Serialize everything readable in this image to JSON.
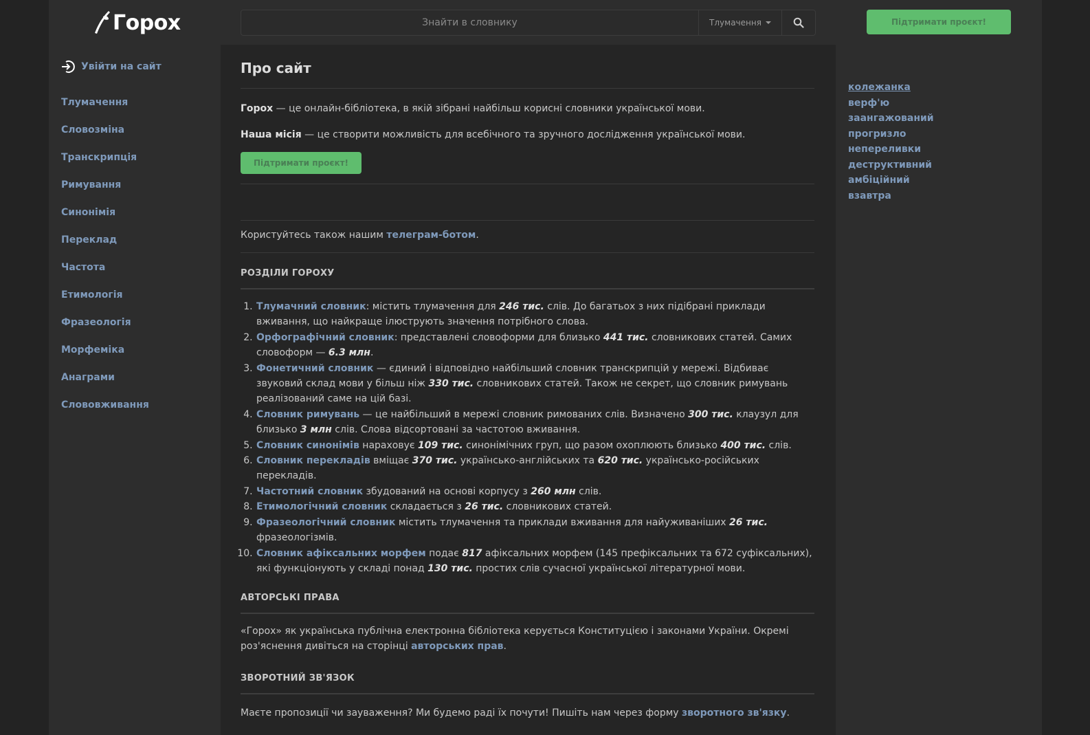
{
  "header": {
    "logo_text": "Горох",
    "search_placeholder": "Знайти в словнику",
    "search_mode": "Тлумачення",
    "support_button": "Підтримати проєкт!"
  },
  "sidebar": {
    "login": "Увійти на сайт",
    "items": [
      "Тлумачення",
      "Словозміна",
      "Транскрипція",
      "Римування",
      "Синонімія",
      "Переклад",
      "Частота",
      "Етимологія",
      "Фразеологія",
      "Морфеміка",
      "Анаграми",
      "Слововживання"
    ]
  },
  "main": {
    "title": "Про сайт",
    "intro": {
      "bold": "Горох",
      "text": " — це онлайн-бібліотека, в якій зібрані найбільш корисні словники української мови."
    },
    "mission": {
      "bold": "Наша місія",
      "text": " — це створити можливість для всебічного та зручного дослідження української мови."
    },
    "support_button": "Підтримати проєкт!",
    "telegram": {
      "before": "Користуйтесь також нашим ",
      "link": "телеграм-ботом",
      "after": "."
    },
    "sections_title": "РОЗДІЛИ ГОРОХУ",
    "sections": [
      {
        "link": "Тлумачний словник",
        "t1": ": містить тлумачення для ",
        "n1": "246 тис.",
        "t2": " слів. До багатьох з них підібрані приклади вживання, що найкраще ілюструють значення потрібного слова.",
        "n2": "",
        "t3": ""
      },
      {
        "link": "Орфографічний словник",
        "t1": ": представлені словоформи для близько ",
        "n1": "441 тис.",
        "t2": " словникових статей. Самих словоформ — ",
        "n2": "6.3 млн",
        "t3": "."
      },
      {
        "link": "Фонетичний словник",
        "t1": " — єдиний і відповідно найбільший словник транскрипцій у мережі. Відбиває звуковий склад мови у більш ніж ",
        "n1": "330 тис.",
        "t2": " словникових статей. Також не секрет, що словник римувань реалізований саме на цій базі.",
        "n2": "",
        "t3": ""
      },
      {
        "link": "Словник римувань",
        "t1": " — це найбільший в мережі словник римованих слів. Визначено ",
        "n1": "300 тис.",
        "t2": " клаузул для близько ",
        "n2": "3 млн",
        "t3": " слів. Слова відсортовані за частотою вживання."
      },
      {
        "link": "Словник синонімів",
        "t1": " нараховує ",
        "n1": "109 тис.",
        "t2": " синонімічних груп, що разом охоплюють близько ",
        "n2": "400 тис.",
        "t3": " слів."
      },
      {
        "link": "Словник перекладів",
        "t1": " вміщає ",
        "n1": "370 тис.",
        "t2": " українсько-англійських та ",
        "n2": "620 тис.",
        "t3": " українсько-російських перекладів."
      },
      {
        "link": "Частотний словник",
        "t1": " збудований на основі корпусу з ",
        "n1": "260 млн",
        "t2": " слів.",
        "n2": "",
        "t3": ""
      },
      {
        "link": "Етимологічний словник",
        "t1": " складається з ",
        "n1": "26 тис.",
        "t2": " словникових статей.",
        "n2": "",
        "t3": ""
      },
      {
        "link": "Фразеологічний словник",
        "t1": " містить тлумачення та приклади вживання для найуживаніших ",
        "n1": "26 тис.",
        "t2": " фразеологізмів.",
        "n2": "",
        "t3": ""
      },
      {
        "link": "Словник афіксальних морфем",
        "t1": " подає ",
        "n1": "817",
        "t2": " афіксальних морфем (145 префіксальних та 672 суфіксальних), які функціонують у складі понад ",
        "n2": "130 тис.",
        "t3": " простих слів сучасної української літературної мови."
      }
    ],
    "copyright_title": "АВТОРСЬКІ ПРАВА",
    "copyright": {
      "before": "«Горох» як українська публічна електронна бібліотека керується Конституцією і законами України. Окремі роз'яснення дивіться на сторінці ",
      "link": "авторських прав",
      "after": "."
    },
    "feedback_title": "ЗВОРОТНИЙ ЗВ'ЯЗОК",
    "feedback": {
      "before": "Маєте пропозиції чи зауваження? Ми будемо раді їх почути! Пишіть нам через форму ",
      "link": "зворотного зв'язку",
      "after": "."
    }
  },
  "recent_words": [
    "колежанка",
    "верф'ю",
    "заангажований",
    "прогризло",
    "непереливки",
    "деструктивний",
    "амбіційний",
    "взавтра"
  ],
  "colors": {
    "link": "#7f9abb",
    "accent_green": "#5fbd6e",
    "background": "#232323",
    "panel": "#2d2d2d",
    "main": "#252525"
  }
}
